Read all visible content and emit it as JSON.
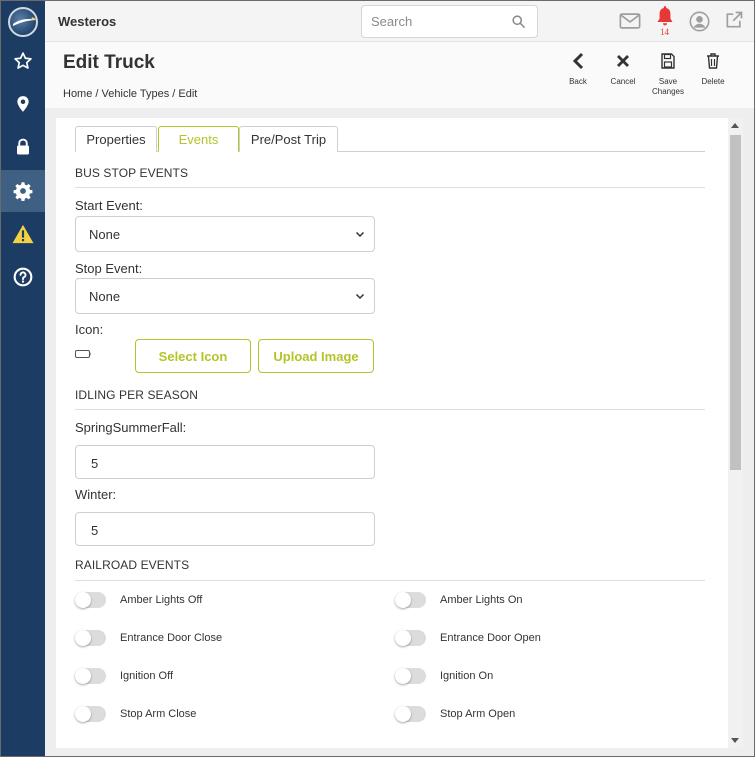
{
  "topbar": {
    "app_title": "Westeros",
    "search_placeholder": "Search",
    "notification_count": "14"
  },
  "header": {
    "title": "Edit Truck",
    "breadcrumb": [
      "Home",
      "Vehicle Types",
      "Edit"
    ],
    "actions": [
      {
        "label": "Back",
        "icon": "chevron-left-icon"
      },
      {
        "label": "Cancel",
        "icon": "x-icon"
      },
      {
        "label": "Save Changes",
        "icon": "save-icon"
      },
      {
        "label": "Delete",
        "icon": "trash-icon"
      }
    ]
  },
  "sidebar": {
    "items": [
      {
        "icon": "star-icon"
      },
      {
        "icon": "map-pin-icon"
      },
      {
        "icon": "lock-icon"
      },
      {
        "icon": "gear-icon",
        "active": true
      },
      {
        "icon": "warning-icon"
      },
      {
        "icon": "help-icon"
      }
    ]
  },
  "tabs": [
    {
      "label": "Properties"
    },
    {
      "label": "Events",
      "active": true
    },
    {
      "label": "Pre/Post Trip"
    }
  ],
  "bus_stop": {
    "title": "BUS STOP EVENTS",
    "start_label": "Start Event:",
    "start_value": "None",
    "stop_label": "Stop Event:",
    "stop_value": "None",
    "icon_label": "Icon:",
    "select_icon": "Select Icon",
    "upload_image": "Upload Image"
  },
  "idling": {
    "title": "IDLING PER SEASON",
    "ssf_label": "SpringSummerFall:",
    "ssf_value": "5",
    "winter_label": "Winter:",
    "winter_value": "5"
  },
  "railroad": {
    "title": "RAILROAD EVENTS",
    "toggles": [
      {
        "label": "Amber Lights Off",
        "on": false
      },
      {
        "label": "Amber Lights On",
        "on": false
      },
      {
        "label": "Entrance Door Close",
        "on": false
      },
      {
        "label": "Entrance Door Open",
        "on": false
      },
      {
        "label": "Ignition Off",
        "on": false
      },
      {
        "label": "Ignition On",
        "on": false
      },
      {
        "label": "Stop Arm Close",
        "on": false
      },
      {
        "label": "Stop Arm Open",
        "on": false
      }
    ]
  },
  "colors": {
    "sidebar": "#1c3c63",
    "accent": "#b5c42a",
    "notification": "#e53935"
  }
}
